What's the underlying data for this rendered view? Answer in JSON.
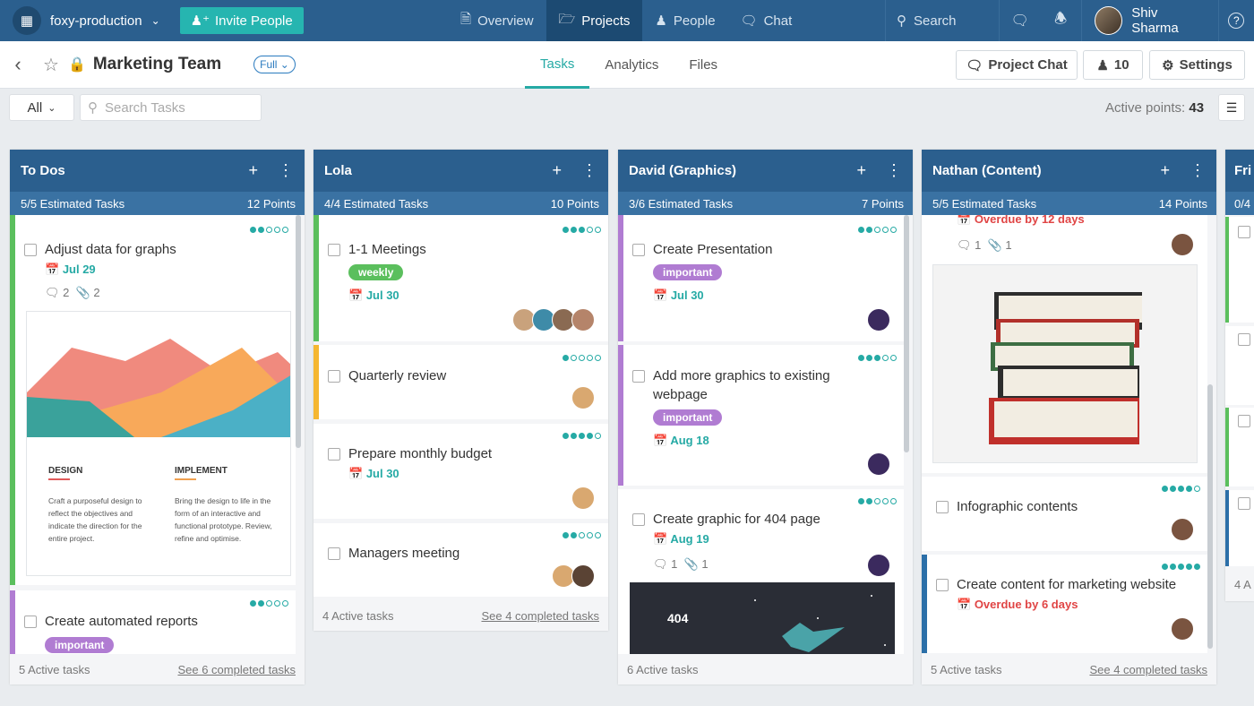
{
  "app": {
    "workspace": "foxy-production",
    "invite_label": "Invite People",
    "nav": [
      {
        "label": "Overview",
        "icon": "document-icon"
      },
      {
        "label": "Projects",
        "icon": "folder-icon"
      },
      {
        "label": "People",
        "icon": "people-icon"
      },
      {
        "label": "Chat",
        "icon": "chat-icon"
      }
    ],
    "search_label": "Search",
    "user_name": "Shiv Sharma"
  },
  "project": {
    "title": "Marketing Team",
    "access": "Full",
    "tabs": [
      "Tasks",
      "Analytics",
      "Files"
    ],
    "project_chat": "Project Chat",
    "members_count": "10",
    "settings": "Settings"
  },
  "toolbar": {
    "filter": "All",
    "search_placeholder": "Search Tasks",
    "active_points_label": "Active points:",
    "active_points": "43"
  },
  "colors": {
    "primary": "#2b5f8e",
    "teal": "#26aaa5",
    "important": "#b07cd2",
    "weekly": "#5bbf5d",
    "overdue": "#e04545"
  },
  "columns": [
    {
      "name": "To Dos",
      "estimated": "5/5 Estimated Tasks",
      "points": "12 Points",
      "active": "5 Active tasks",
      "completed": "See 6 completed tasks",
      "cards": [
        {
          "title": "Adjust data for graphs",
          "date": "Jul 29",
          "comments": "2",
          "attachments": "2",
          "priority": 2
        },
        {
          "title": "Create automated reports",
          "tag": "important",
          "priority": 2
        }
      ],
      "thumb": {
        "h1": "DESIGN",
        "p1": "Craft a purposeful design to reflect the objectives and indicate the direction for the entire project.",
        "h2": "IMPLEMENT",
        "p2": "Bring the design to life in the form of an interactive and functional prototype. Review, refine and optimise."
      }
    },
    {
      "name": "Lola",
      "estimated": "4/4 Estimated Tasks",
      "points": "10 Points",
      "active": "4 Active tasks",
      "completed": "See 4 completed tasks",
      "cards": [
        {
          "title": "1-1 Meetings",
          "tag": "weekly",
          "date": "Jul 30",
          "priority": 3
        },
        {
          "title": "Quarterly review",
          "priority": 1
        },
        {
          "title": "Prepare monthly budget",
          "date": "Jul 30",
          "priority": 4
        },
        {
          "title": "Managers meeting",
          "priority": 2
        }
      ]
    },
    {
      "name": "David (Graphics)",
      "estimated": "3/6 Estimated Tasks",
      "points": "7 Points",
      "active": "6 Active tasks",
      "cards": [
        {
          "title": "Create Presentation",
          "tag": "important",
          "date": "Jul 30",
          "priority": 2
        },
        {
          "title": "Add more graphics to existing webpage",
          "tag": "important",
          "date": "Aug 18",
          "priority": 3
        },
        {
          "title": "Create graphic for 404 page",
          "date": "Aug 19",
          "comments": "1",
          "attachments": "1",
          "priority": 2
        }
      ],
      "thumb_text": "404"
    },
    {
      "name": "Nathan (Content)",
      "estimated": "5/5 Estimated Tasks",
      "points": "14 Points",
      "active": "5 Active tasks",
      "completed": "See 4 completed tasks",
      "cards": [
        {
          "overdue": "Overdue by 12 days",
          "comments": "1",
          "attachments": "1"
        },
        {
          "title": "Infographic contents",
          "priority": 4
        },
        {
          "title": "Create content for marketing website",
          "overdue": "Overdue by 6 days",
          "priority": 5
        }
      ]
    },
    {
      "name": "Fri",
      "estimated": "0/4",
      "active": "4 A"
    }
  ]
}
